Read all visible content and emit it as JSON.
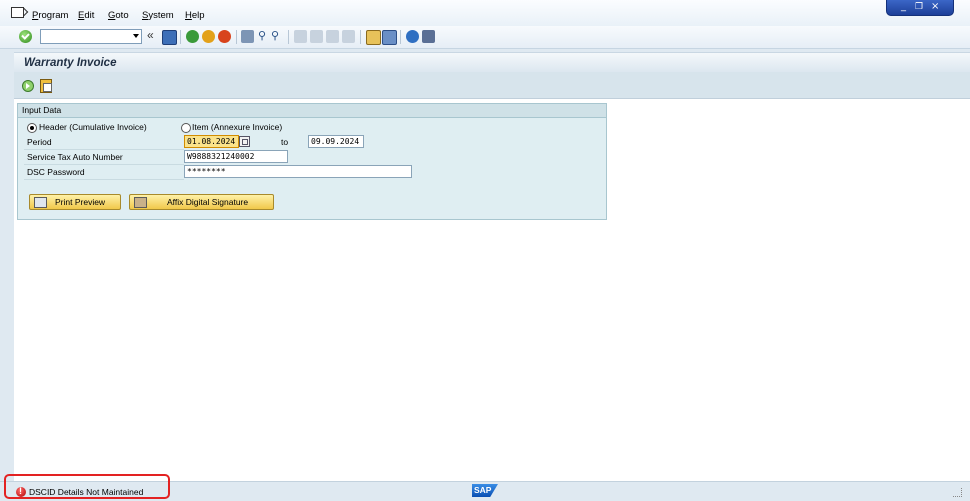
{
  "menu": {
    "items": [
      "Program",
      "Edit",
      "Goto",
      "System",
      "Help"
    ]
  },
  "window": {
    "controls": [
      "_",
      "❐",
      "×"
    ]
  },
  "page": {
    "title": "Warranty Invoice"
  },
  "input_group": {
    "title": "Input Data",
    "radio_header_label": "Header (Cumulative Invoice)",
    "radio_item_label": "Item (Annexure Invoice)",
    "selected_radio": "header",
    "period_label": "Period",
    "period_from": "01.08.2024",
    "period_to_label": "to",
    "period_to": "09.09.2024",
    "service_tax_label": "Service Tax Auto Number",
    "service_tax_value": "W9888321240002",
    "dsc_password_label": "DSC Password",
    "dsc_password_value": "********",
    "print_preview_label": "Print Preview",
    "affix_signature_label": "Affix Digital Signature"
  },
  "status": {
    "message": "DSCID Details Not Maintained",
    "type": "error",
    "highlight_color": "#e32222"
  },
  "brand": {
    "logo_text": "SAP"
  }
}
